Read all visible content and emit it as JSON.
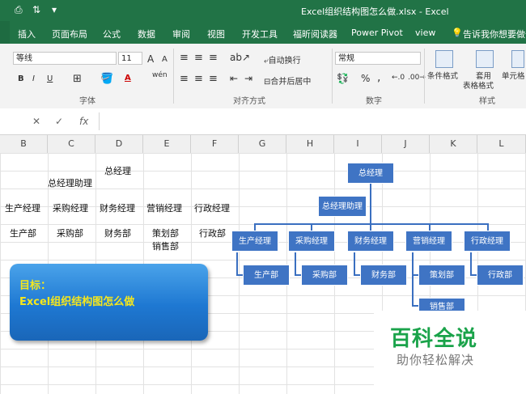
{
  "titlebar": {
    "title": "Excel组织结构图怎么做.xlsx  -  Excel",
    "qa_icons": [
      "print-preview-icon",
      "sort-icon",
      "customize-icon"
    ]
  },
  "tabs": [
    "插入",
    "页面布局",
    "公式",
    "数据",
    "审阅",
    "视图",
    "开发工具",
    "福昕阅读器",
    "Power Pivot",
    "view",
    "告诉我你想要做什"
  ],
  "ribbon": {
    "font_name": "等线",
    "font_size": "11",
    "grow_font": "A",
    "shrink_font": "A",
    "bold": "B",
    "italic": "I",
    "underline": "U",
    "font_color": "A",
    "wen": "wén",
    "wrap_text": "自动换行",
    "merge_center": "合并后居中",
    "number_format": "常规",
    "percent": "%",
    "comma": ",",
    "cond_format": "条件格式",
    "table_format_1": "套用",
    "table_format_2": "表格格式",
    "cell_styles": "单元格",
    "group_font": "字体",
    "group_align": "对齐方式",
    "group_number": "数字",
    "group_styles": "样式"
  },
  "formula_bar": {
    "fx": "fx",
    "cancel": "✕",
    "enter": "✓"
  },
  "columns": [
    "B",
    "C",
    "D",
    "E",
    "F",
    "G",
    "H",
    "I",
    "J",
    "K",
    "L"
  ],
  "cells": {
    "ceo": "总经理",
    "ceo_assistant": "总经理助理",
    "b_row": "生产经理",
    "c_row": "采购经理",
    "d_row": "财务经理",
    "e_row": "营销经理",
    "f_row": "行政经理",
    "b_dept": "生产部",
    "c_dept": "采购部",
    "d_dept": "财务部",
    "e_dept": "策划部",
    "e_dept2": "销售部",
    "f_dept": "行政部"
  },
  "org": {
    "ceo": "总经理",
    "assistant": "总经理助理",
    "managers": [
      "生产经理",
      "采购经理",
      "财务经理",
      "营销经理",
      "行政经理"
    ],
    "depts": [
      "生产部",
      "采购部",
      "财务部",
      "策划部",
      "行政部"
    ],
    "extra": "销售部"
  },
  "callout": {
    "line1": "目标：",
    "line2": "Excel组织结构图怎么做"
  },
  "watermark": {
    "big": "百科全说",
    "small": "助你轻松解决"
  },
  "colors": {
    "excel_green": "#217346",
    "node_blue": "#3f74c4",
    "callout_text": "#f6e71c",
    "watermark_green": "#1aa34a"
  }
}
